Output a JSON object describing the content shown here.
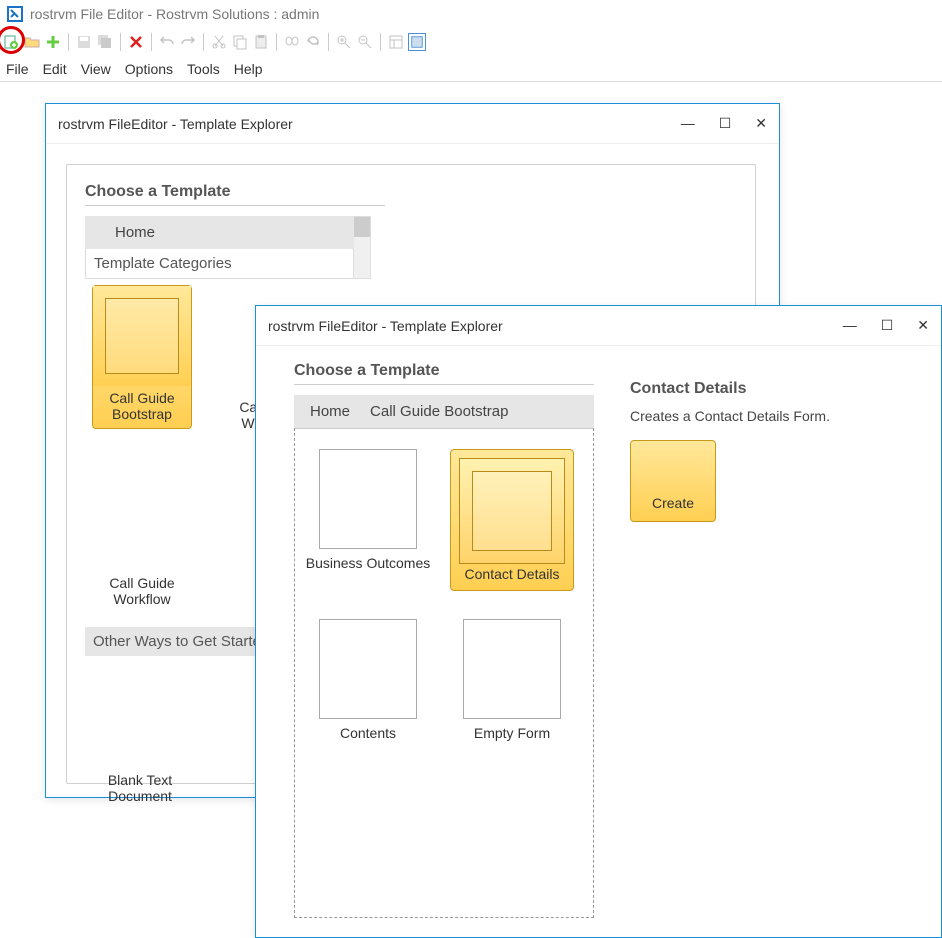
{
  "app": {
    "title": "rostrvm File Editor - Rostrvm Solutions : admin"
  },
  "menu": {
    "file": "File",
    "edit": "Edit",
    "view": "View",
    "options": "Options",
    "tools": "Tools",
    "help": "Help"
  },
  "dialog1": {
    "title": "rostrvm FileEditor - Template Explorer",
    "heading": "Choose a Template",
    "breadcrumb_home": "Home",
    "section_categories": "Template Categories",
    "templates": {
      "cg_bootstrap": "Call Guide\nBootstrap",
      "cg_webform": "Call Guide\nWebForm",
      "cg_workflow": "Call Guide\nWorkflow"
    },
    "other_ways": "Other Ways to Get Started",
    "blank": "Blank Text\nDocument"
  },
  "dialog2": {
    "title": "rostrvm FileEditor - Template Explorer",
    "heading": "Choose a Template",
    "breadcrumb_home": "Home",
    "breadcrumb_cat": "Call Guide Bootstrap",
    "templates": {
      "business_outcomes": "Business Outcomes",
      "contact_details": "Contact Details",
      "contents": "Contents",
      "empty_form": "Empty Form"
    },
    "details": {
      "title": "Contact Details",
      "desc": "Creates a Contact Details Form.",
      "create": "Create"
    }
  }
}
